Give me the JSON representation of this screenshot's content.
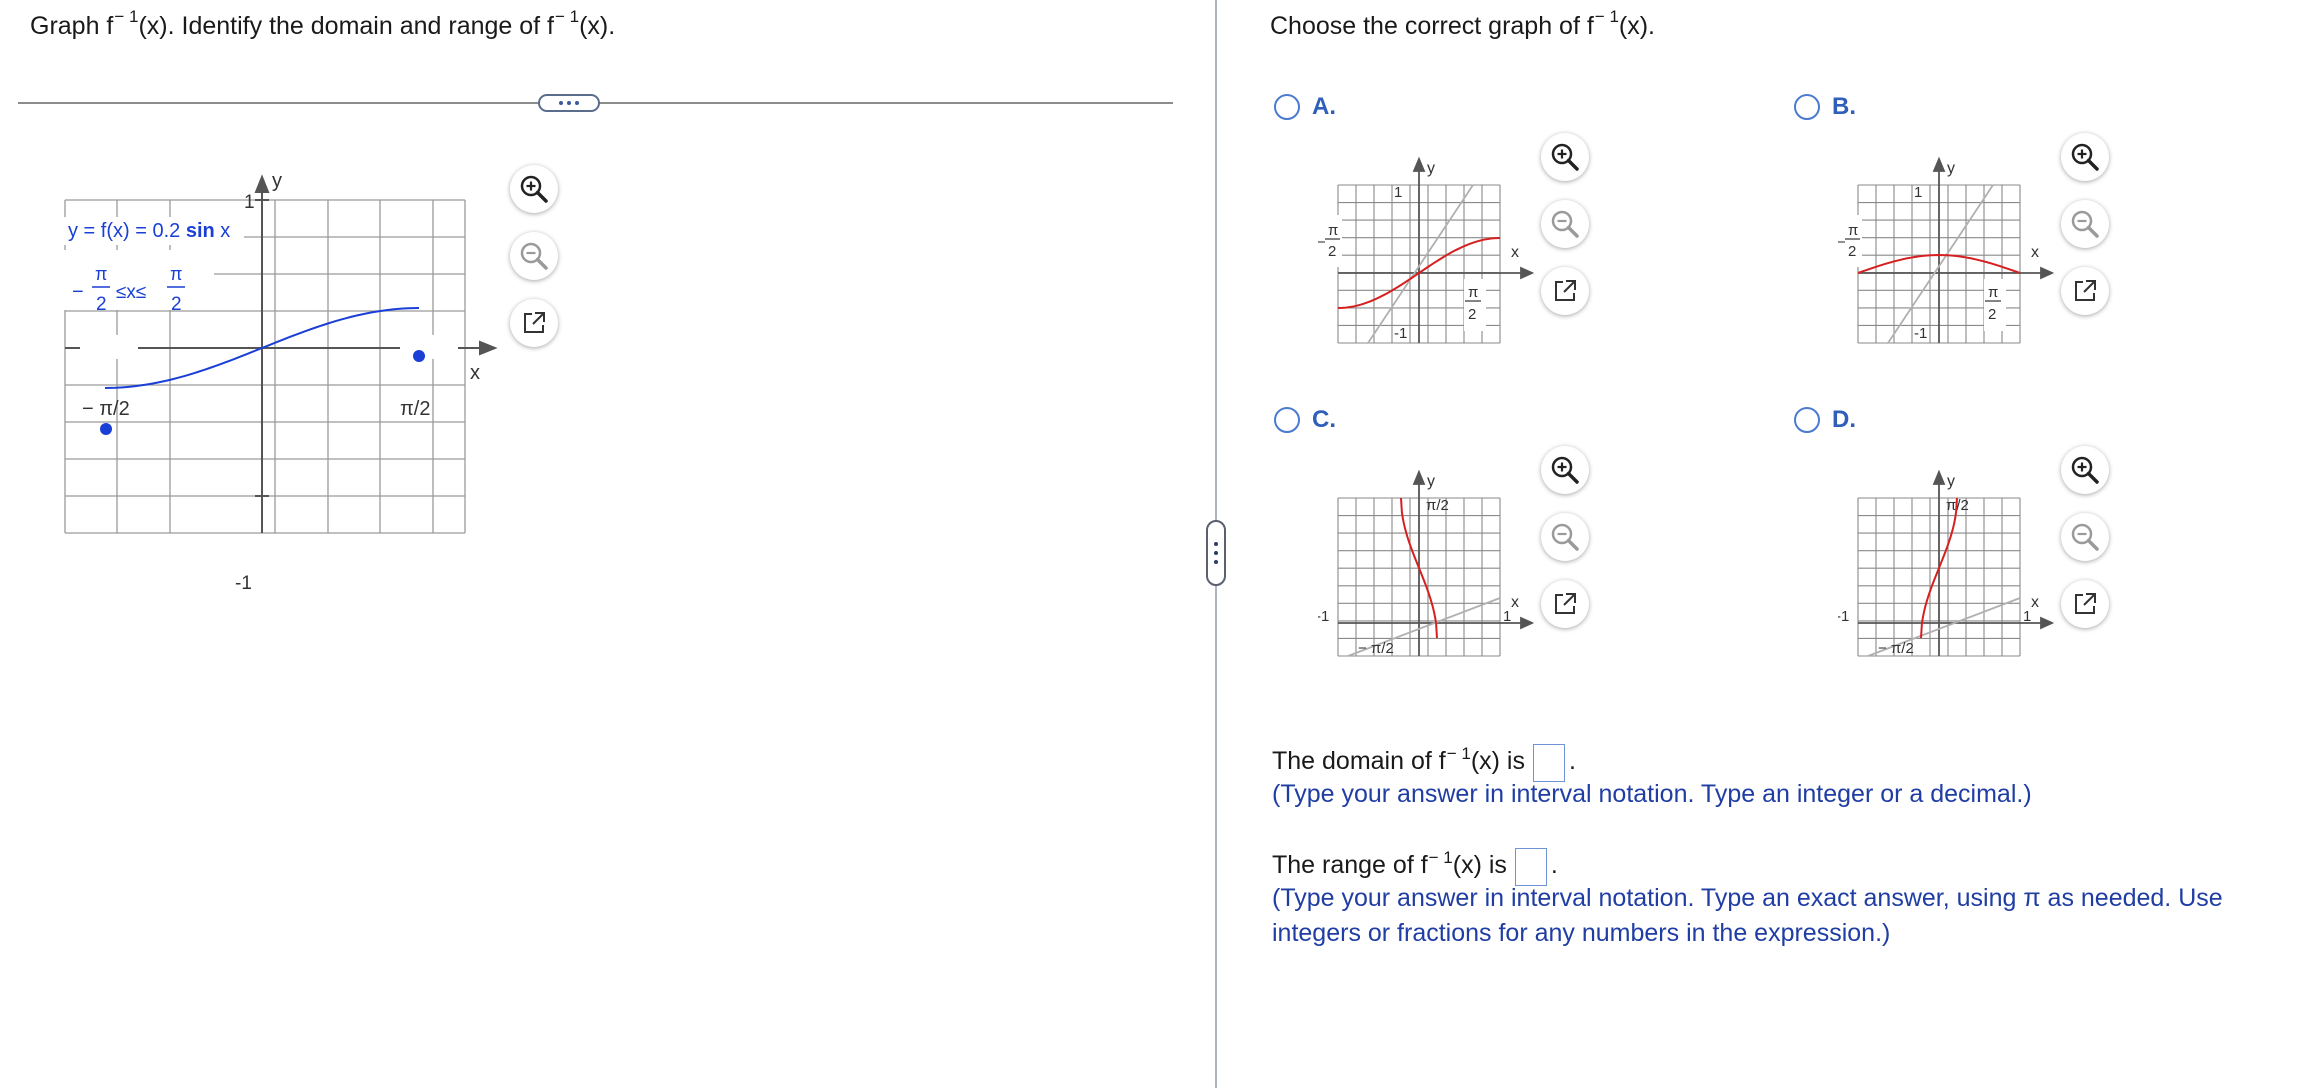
{
  "left": {
    "question_prefix": "Graph f",
    "question_sup": "− 1",
    "question_mid": "(x). Identify the domain and range of f",
    "question_sup2": "− 1",
    "question_suffix": "(x).",
    "graph": {
      "function_label_prefix": "y = f(x) = 0.2 ",
      "function_label_bold": "sin",
      "function_label_suffix": " x",
      "domain_neg": "−",
      "domain_pi": "π",
      "domain_two": "2",
      "domain_rel": "≤x≤",
      "x_axis_label": "x",
      "y_axis_label": "y",
      "y_tick_top": "1",
      "y_tick_bottom": "-1",
      "x_tick_left": "− π/2",
      "x_tick_right": "π/2",
      "curve_color": "#1a3fd6"
    }
  },
  "more_button_label": "…",
  "right": {
    "prompt_prefix": "Choose the correct graph of f",
    "prompt_sup": "− 1",
    "prompt_suffix": "(x).",
    "options": [
      {
        "letter": "A.",
        "ticks": {
          "top": "1",
          "bottom": "-1",
          "left_top": "π",
          "left_bottom": "2",
          "right_top": "π",
          "right_bottom": "2"
        }
      },
      {
        "letter": "B.",
        "ticks": {
          "top": "1",
          "bottom": "-1",
          "left_top": "π",
          "left_bottom": "2",
          "right_top": "π",
          "right_bottom": "2"
        }
      },
      {
        "letter": "C.",
        "ticks": {
          "top": "π/2",
          "bottom": "− π/2",
          "left": "-1",
          "right": "1"
        }
      },
      {
        "letter": "D.",
        "ticks": {
          "top": "π/2",
          "bottom": "− π/2",
          "left": "-1",
          "right": "1"
        }
      }
    ],
    "axis_x": "x",
    "axis_y": "y",
    "domain_prefix": "The domain of f",
    "domain_sup": "− 1",
    "domain_suffix": "(x) is",
    "domain_value": "",
    "domain_hint": "(Type your answer in interval notation. Type an integer or a decimal.)",
    "range_prefix": "The range of f",
    "range_sup": "− 1",
    "range_suffix": "(x) is",
    "range_value": "",
    "range_hint_line1": "(Type your answer in interval notation. Type an exact answer, using π as needed. Use",
    "range_hint_line2": "integers or fractions for any numbers in the expression.)",
    "period": "."
  },
  "colors": {
    "accent_blue": "#2f5fba",
    "hint_blue": "#1f3da3",
    "curve_red": "#d61f1f",
    "identity_gray": "#b0b0b0"
  },
  "icons": [
    "zoom-in-icon",
    "zoom-out-icon",
    "open-window-icon"
  ]
}
